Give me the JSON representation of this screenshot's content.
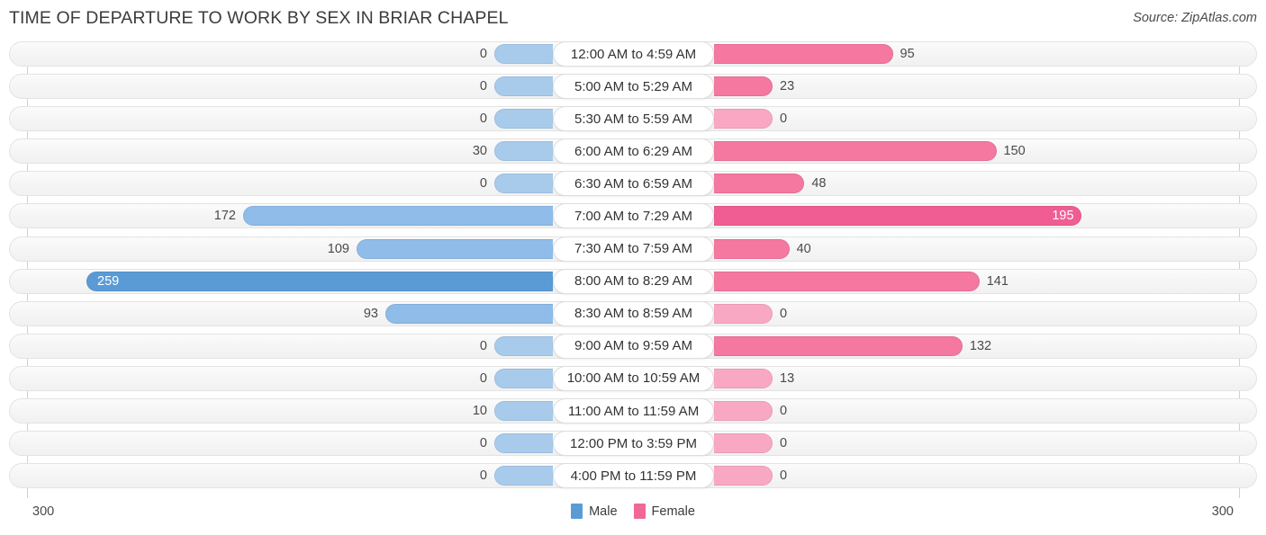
{
  "header": {
    "title": "TIME OF DEPARTURE TO WORK BY SEX IN BRIAR CHAPEL",
    "source": "Source: ZipAtlas.com"
  },
  "axis": {
    "left_label": "300",
    "right_label": "300",
    "max": 300
  },
  "legend": {
    "items": [
      {
        "label": "Male",
        "color": "#5b9bd5"
      },
      {
        "label": "Female",
        "color": "#f0689a"
      }
    ]
  },
  "colors": {
    "male_strong": "#5b9bd5",
    "male_mid": "#8fbce8",
    "male_light": "#a8cbec",
    "female_strong": "#ef5d92",
    "female_mid": "#f4789f",
    "female_light": "#f9a8c3",
    "track": "#f5f5f5",
    "pill": "#ffffff"
  },
  "chart_data": {
    "type": "bar",
    "orientation": "horizontal-diverging",
    "title": "TIME OF DEPARTURE TO WORK BY SEX IN BRIAR CHAPEL",
    "xlabel": "",
    "ylabel": "",
    "xlim": [
      300,
      300
    ],
    "grid": false,
    "legend_position": "bottom-center",
    "categories": [
      "12:00 AM to 4:59 AM",
      "5:00 AM to 5:29 AM",
      "5:30 AM to 5:59 AM",
      "6:00 AM to 6:29 AM",
      "6:30 AM to 6:59 AM",
      "7:00 AM to 7:29 AM",
      "7:30 AM to 7:59 AM",
      "8:00 AM to 8:29 AM",
      "8:30 AM to 8:59 AM",
      "9:00 AM to 9:59 AM",
      "10:00 AM to 10:59 AM",
      "11:00 AM to 11:59 AM",
      "12:00 PM to 3:59 PM",
      "4:00 PM to 11:59 PM"
    ],
    "series": [
      {
        "name": "Male",
        "values": [
          0,
          0,
          0,
          30,
          0,
          172,
          109,
          259,
          93,
          0,
          0,
          10,
          0,
          0
        ]
      },
      {
        "name": "Female",
        "values": [
          95,
          23,
          0,
          150,
          48,
          195,
          40,
          141,
          0,
          132,
          13,
          0,
          0,
          0
        ]
      }
    ]
  },
  "rows": [
    {
      "label": "12:00 AM to 4:59 AM",
      "male": "0",
      "female": "95"
    },
    {
      "label": "5:00 AM to 5:29 AM",
      "male": "0",
      "female": "23"
    },
    {
      "label": "5:30 AM to 5:59 AM",
      "male": "0",
      "female": "0"
    },
    {
      "label": "6:00 AM to 6:29 AM",
      "male": "30",
      "female": "150"
    },
    {
      "label": "6:30 AM to 6:59 AM",
      "male": "0",
      "female": "48"
    },
    {
      "label": "7:00 AM to 7:29 AM",
      "male": "172",
      "female": "195"
    },
    {
      "label": "7:30 AM to 7:59 AM",
      "male": "109",
      "female": "40"
    },
    {
      "label": "8:00 AM to 8:29 AM",
      "male": "259",
      "female": "141"
    },
    {
      "label": "8:30 AM to 8:59 AM",
      "male": "93",
      "female": "0"
    },
    {
      "label": "9:00 AM to 9:59 AM",
      "male": "0",
      "female": "132"
    },
    {
      "label": "10:00 AM to 10:59 AM",
      "male": "0",
      "female": "13"
    },
    {
      "label": "11:00 AM to 11:59 AM",
      "male": "10",
      "female": "0"
    },
    {
      "label": "12:00 PM to 3:59 PM",
      "male": "0",
      "female": "0"
    },
    {
      "label": "4:00 PM to 11:59 PM",
      "male": "0",
      "female": "0"
    }
  ]
}
